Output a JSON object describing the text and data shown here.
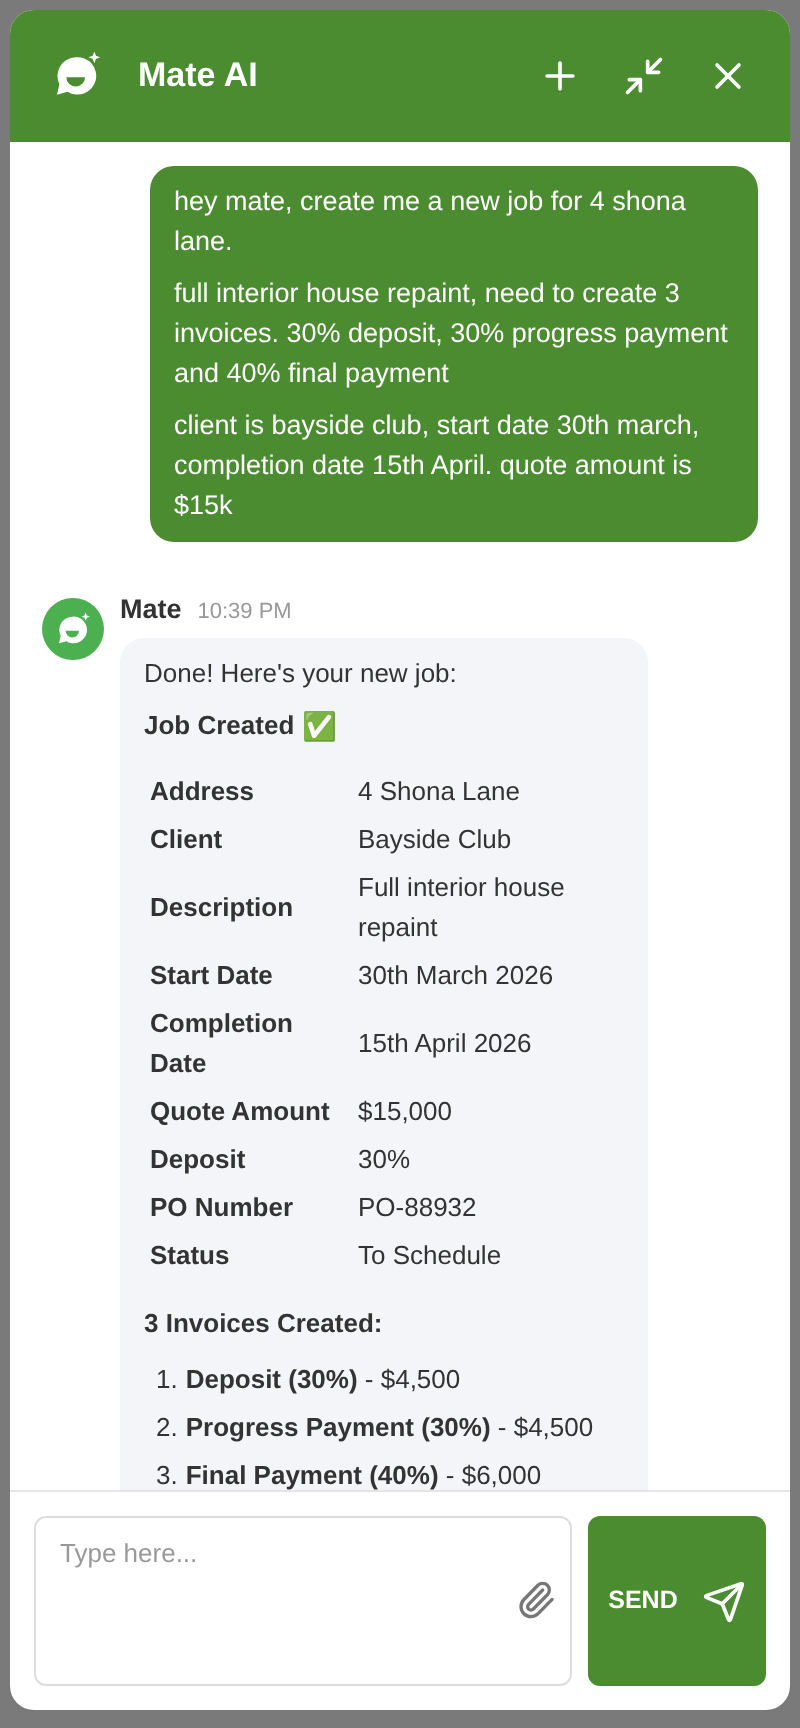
{
  "header": {
    "title": "Mate AI"
  },
  "user_message": {
    "paragraphs": [
      "hey mate, create me a new job for 4 shona lane.",
      "full interior house repaint, need to create 3 invoices. 30% deposit, 30% progress payment and 40% final payment",
      "client is bayside club, start date 30th march, completion date 15th April. quote amount is $15k"
    ]
  },
  "bot_message": {
    "sender": "Mate",
    "time": "10:39 PM",
    "intro": "Done! Here's your new job:",
    "heading": "Job Created",
    "heading_emoji": "✅",
    "fields": [
      {
        "label": "Address",
        "value": "4 Shona Lane"
      },
      {
        "label": "Client",
        "value": "Bayside Club"
      },
      {
        "label": "Description",
        "value": "Full interior house repaint"
      },
      {
        "label": "Start Date",
        "value": "30th March 2026"
      },
      {
        "label": "Completion Date",
        "value": "15th April 2026"
      },
      {
        "label": "Quote Amount",
        "value": "$15,000"
      },
      {
        "label": "Deposit",
        "value": "30%"
      },
      {
        "label": "PO Number",
        "value": "PO-88932"
      },
      {
        "label": "Status",
        "value": "To Schedule"
      }
    ],
    "invoices_heading": "3 Invoices Created:",
    "invoices": [
      {
        "number": "1.",
        "text": "**Deposit (30%)** - $4,500"
      },
      {
        "number": "2.",
        "text": "**Progress Payment (30%)** - $4,500"
      },
      {
        "number": "3.",
        "text": "**Final Payment (40%)** - $6,000"
      }
    ]
  },
  "composer": {
    "placeholder": "Type here...",
    "send_label": "SEND"
  }
}
